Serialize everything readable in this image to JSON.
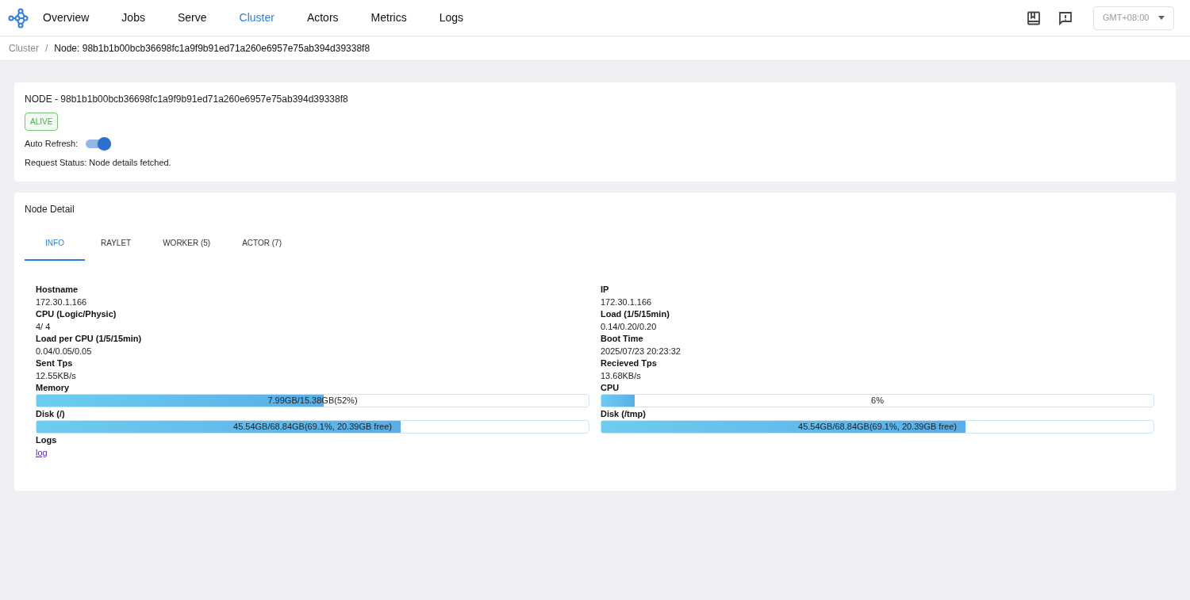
{
  "nav": {
    "items": [
      {
        "label": "Overview",
        "selected": false
      },
      {
        "label": "Jobs",
        "selected": false
      },
      {
        "label": "Serve",
        "selected": false
      },
      {
        "label": "Cluster",
        "selected": true
      },
      {
        "label": "Actors",
        "selected": false
      },
      {
        "label": "Metrics",
        "selected": false
      },
      {
        "label": "Logs",
        "selected": false
      }
    ],
    "timezone": "GMT+08:00"
  },
  "breadcrumb": {
    "parent": "Cluster",
    "separator": "/",
    "current": "Node: 98b1b1b00bcb36698fc1a9f9b91ed71a260e6957e75ab394d39338f8"
  },
  "node_card": {
    "title": "NODE - 98b1b1b00bcb36698fc1a9f9b91ed71a260e6957e75ab394d39338f8",
    "status": "ALIVE",
    "auto_refresh": {
      "label": "Auto Refresh:",
      "on": true
    },
    "request_status": "Request Status: Node details fetched."
  },
  "detail": {
    "title": "Node Detail",
    "tabs": [
      {
        "label": "INFO",
        "selected": true
      },
      {
        "label": "RAYLET",
        "selected": false
      },
      {
        "label": "WORKER (5)",
        "selected": false
      },
      {
        "label": "ACTOR (7)",
        "selected": false
      }
    ],
    "fields": [
      {
        "kind": "text",
        "label": "Hostname",
        "value": "172.30.1.166"
      },
      {
        "kind": "text",
        "label": "IP",
        "value": "172.30.1.166"
      },
      {
        "kind": "text",
        "label": "CPU (Logic/Physic)",
        "value": "4/ 4"
      },
      {
        "kind": "text",
        "label": "Load (1/5/15min)",
        "value": "0.14/0.20/0.20"
      },
      {
        "kind": "text",
        "label": "Load per CPU (1/5/15min)",
        "value": "0.04/0.05/0.05"
      },
      {
        "kind": "text",
        "label": "Boot Time",
        "value": "2025/07/23 20:23:32"
      },
      {
        "kind": "text",
        "label": "Sent Tps",
        "value": "12.55KB/s"
      },
      {
        "kind": "text",
        "label": "Recieved Tps",
        "value": "13.68KB/s"
      },
      {
        "kind": "bar",
        "label": "Memory",
        "value": "7.99GB/15.38GB(52%)",
        "level": 0.52
      },
      {
        "kind": "bar",
        "label": "CPU",
        "value": "6%",
        "level": 0.06
      },
      {
        "kind": "bar",
        "label": "Disk (/)",
        "value": "45.54GB/68.84GB(69.1%, 20.39GB free)",
        "level": 0.66
      },
      {
        "kind": "bar",
        "label": "Disk (/tmp)",
        "value": "45.54GB/68.84GB(69.1%, 20.39GB free)",
        "level": 0.66
      },
      {
        "kind": "link",
        "label": "Logs",
        "value": "log"
      }
    ]
  }
}
